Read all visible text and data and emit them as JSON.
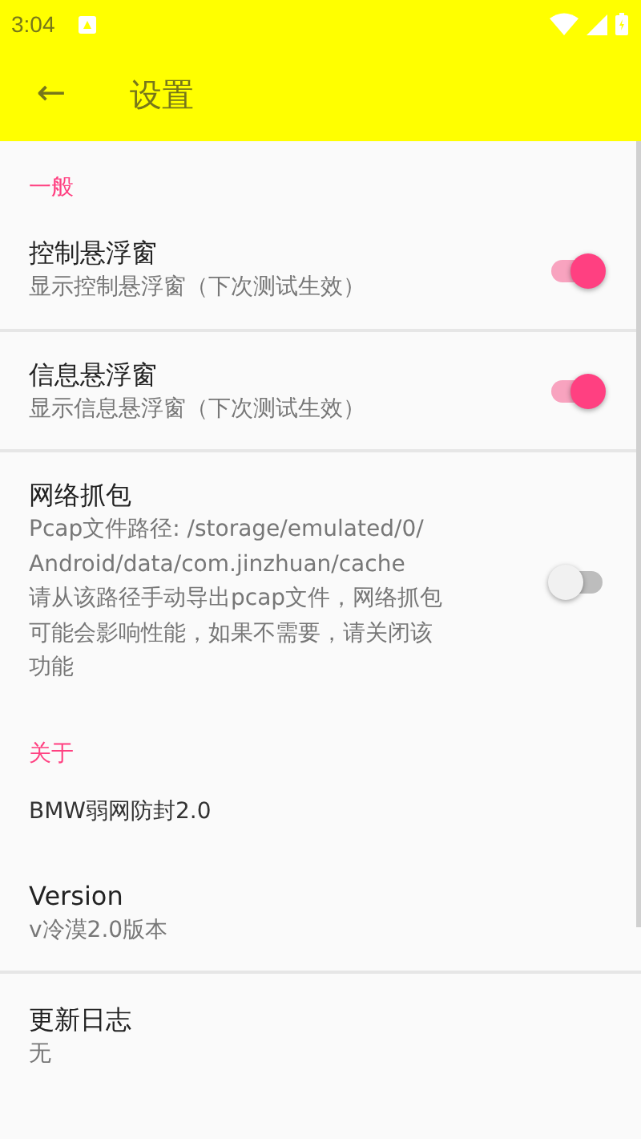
{
  "status_bar": {
    "time": "3:04"
  },
  "app_bar": {
    "back_icon": "←",
    "title": "设置"
  },
  "sections": [
    {
      "header": "一般",
      "items": [
        {
          "kind": "switch",
          "title": "控制悬浮窗",
          "summary": [
            "显示控制悬浮窗（下次测试生效）"
          ],
          "on": true,
          "divider": true
        },
        {
          "kind": "switch",
          "title": "信息悬浮窗",
          "summary": [
            "显示信息悬浮窗（下次测试生效）"
          ],
          "on": true,
          "divider": true
        },
        {
          "kind": "switch",
          "title": "网络抓包",
          "summary": [
            "Pcap文件路径: /storage/emulated/0/",
            "Android/data/com.jinzhuan/cache",
            "请从该路径手动导出pcap文件，网络抓包",
            "可能会影响性能，如果不需要，请关闭该",
            "功能"
          ],
          "on": false,
          "divider": false
        }
      ]
    },
    {
      "header": "关于",
      "items": [
        {
          "kind": "plain",
          "title": "BMW弱网防封2.0",
          "divider": false
        },
        {
          "kind": "text",
          "title": "Version",
          "summary": [
            "v冷漠2.0版本"
          ],
          "divider": true
        },
        {
          "kind": "text",
          "title": "更新日志",
          "summary": [
            "无"
          ],
          "divider": false
        }
      ]
    }
  ]
}
